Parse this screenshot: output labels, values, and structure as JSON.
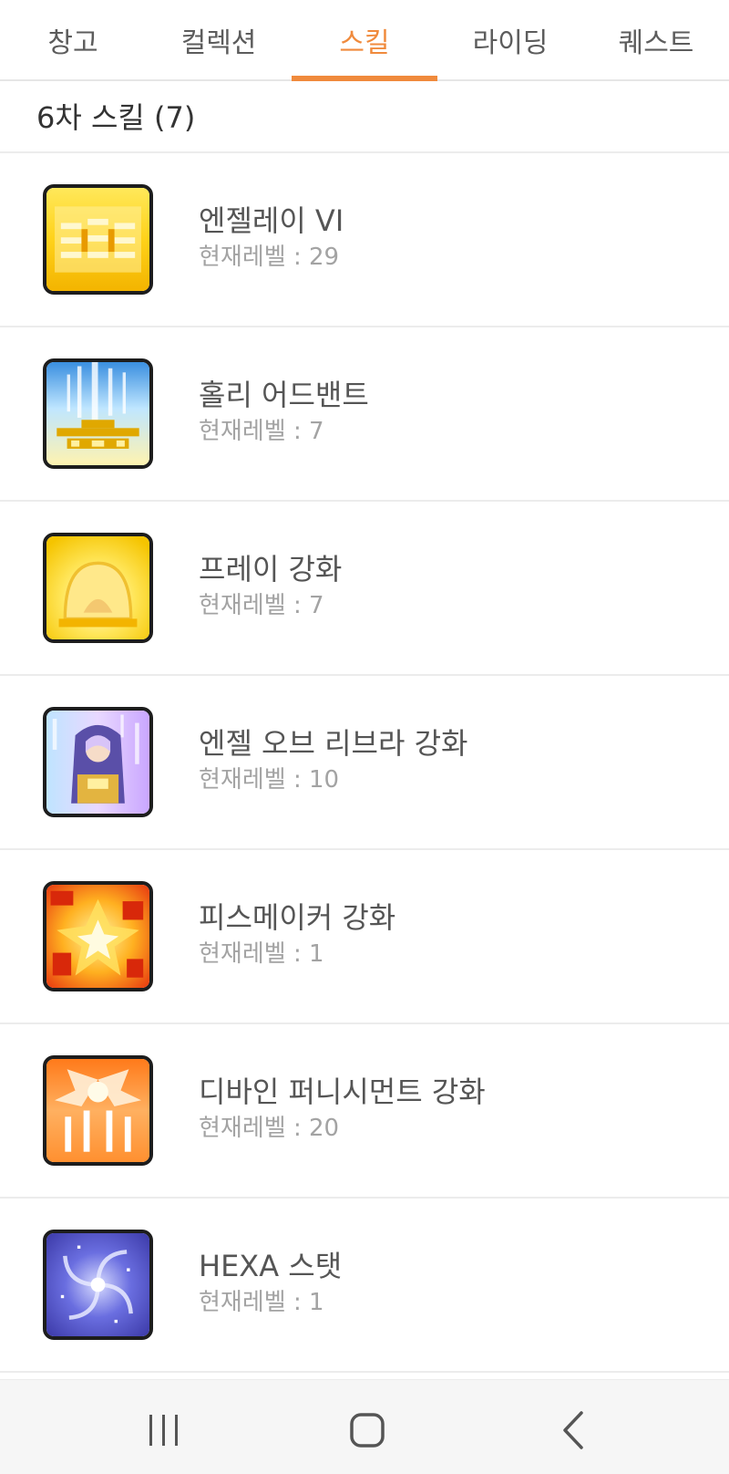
{
  "tabs": [
    {
      "label": "창고",
      "active": false
    },
    {
      "label": "컬렉션",
      "active": false
    },
    {
      "label": "스킬",
      "active": true
    },
    {
      "label": "라이딩",
      "active": false
    },
    {
      "label": "퀘스트",
      "active": false
    }
  ],
  "section": {
    "title": "6차 스킬 (7)"
  },
  "skills": [
    {
      "name": "엔젤레이 VI",
      "level": "현재레벨 : 29",
      "icon": "angel-ray-icon"
    },
    {
      "name": "홀리 어드밴트",
      "level": "현재레벨 : 7",
      "icon": "holy-advent-icon"
    },
    {
      "name": "프레이 강화",
      "level": "현재레벨 : 7",
      "icon": "pray-icon"
    },
    {
      "name": "엔젤 오브 리브라 강화",
      "level": "현재레벨 : 10",
      "icon": "angel-of-libra-icon"
    },
    {
      "name": "피스메이커 강화",
      "level": "현재레벨 : 1",
      "icon": "peacemaker-icon"
    },
    {
      "name": "디바인 퍼니시먼트 강화",
      "level": "현재레벨 : 20",
      "icon": "divine-punishment-icon"
    },
    {
      "name": "HEXA 스탯",
      "level": "현재레벨 : 1",
      "icon": "hexa-stat-icon"
    }
  ],
  "colors": {
    "accent": "#f08a3c",
    "divider": "#ececec",
    "level_text": "#a3a3a3"
  },
  "navbar": {
    "buttons": [
      "recent-apps-icon",
      "home-icon",
      "back-icon"
    ]
  }
}
